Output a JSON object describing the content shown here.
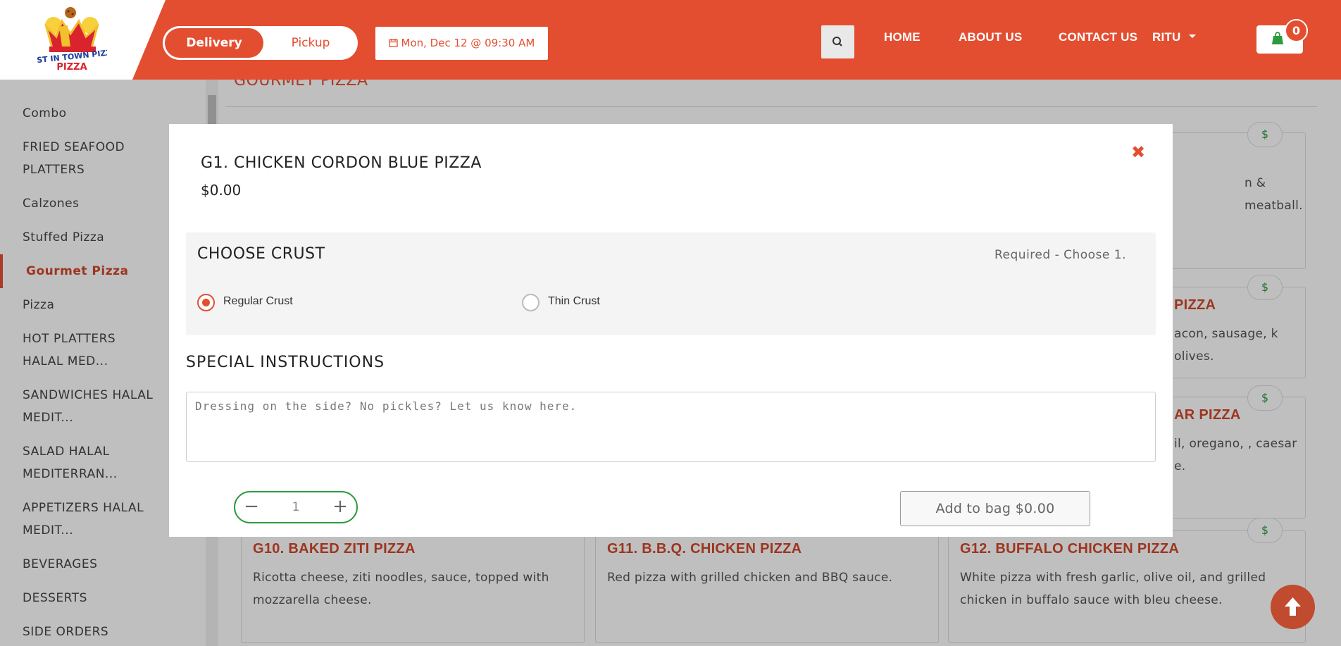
{
  "header": {
    "logo_text": "BEST IN TOWN PIZZA",
    "order_type": {
      "active": "Delivery",
      "inactive": "Pickup"
    },
    "datetime": "Mon, Dec 12 @ 09:30 AM",
    "nav": [
      "HOME",
      "ABOUT US",
      "CONTACT US",
      "RITU"
    ],
    "cart_count": "0"
  },
  "sidebar": {
    "items": [
      "Combo",
      "FRIED SEAFOOD PLATTERS",
      "Calzones",
      "Stuffed Pizza",
      "Gourmet Pizza",
      "Pizza",
      "HOT PLATTERS HALAL MED...",
      "SANDWICHES HALAL MEDIT...",
      "SALAD HALAL MEDITERRAN...",
      "APPETIZERS HALAL MEDIT...",
      "BEVERAGES",
      "DESSERTS",
      "SIDE ORDERS"
    ],
    "active_index": 4
  },
  "main": {
    "section_title": "GOURMET PIZZA",
    "price_symbol": "$",
    "cards": [
      {
        "name": "",
        "desc": "n & meatball."
      },
      {
        "name": "PIZZA",
        "desc": "acon, sausage, k olives."
      },
      {
        "name": "AR PIZZA",
        "desc": "il, oregano, , caesar e."
      },
      {
        "name": "G10. BAKED ZITI PIZZA",
        "desc": "Ricotta cheese, ziti noodles, sauce, topped with mozzarella cheese."
      },
      {
        "name": "G11. B.B.Q. CHICKEN PIZZA",
        "desc": "Red pizza with grilled chicken and BBQ sauce."
      },
      {
        "name": "G12. BUFFALO CHICKEN PIZZA",
        "desc": "White pizza with fresh garlic, olive oil, and grilled chicken in buffalo sauce with bleu cheese."
      }
    ]
  },
  "modal": {
    "title": "G1. CHICKEN CORDON BLUE PIZZA",
    "price": "$0.00",
    "crust": {
      "title": "CHOOSE CRUST",
      "requirement": "Required - Choose 1.",
      "options": [
        "Regular Crust",
        "Thin Crust"
      ],
      "selected": "Regular Crust"
    },
    "special_instructions": {
      "title": "SPECIAL INSTRUCTIONS",
      "placeholder": "Dressing on the side? No pickles? Let us know here."
    },
    "quantity": "1",
    "minus_symbol": "−",
    "plus_symbol": "+",
    "add_button": "Add to bag $0.00"
  },
  "colors": {
    "accent": "#e44e30",
    "green": "#2e9a3e"
  },
  "icons": [
    "calendar-icon",
    "search-icon",
    "caret-down-icon",
    "shopping-bag-icon",
    "close-icon",
    "arrow-up-icon"
  ]
}
